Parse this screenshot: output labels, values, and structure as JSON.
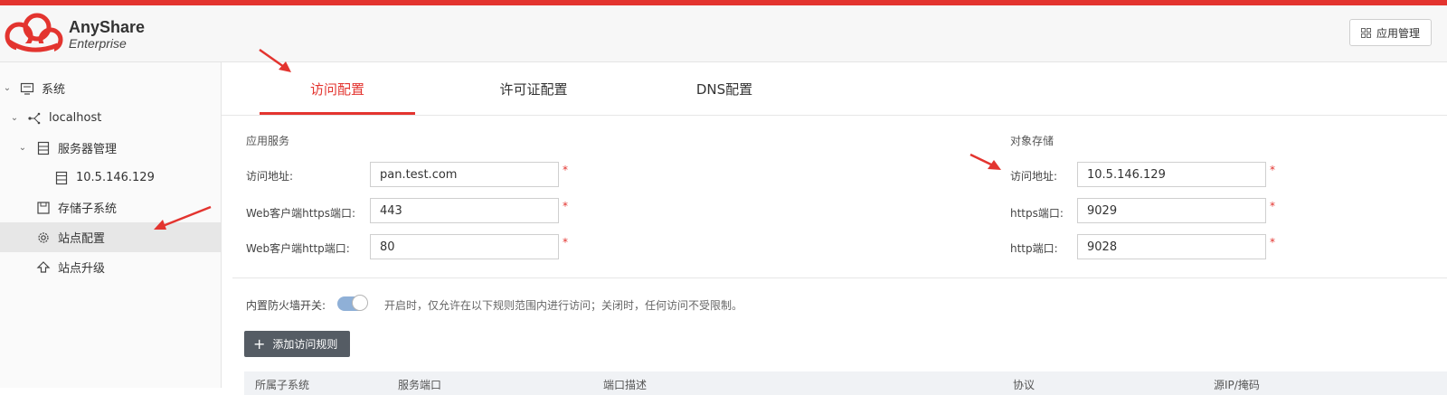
{
  "header": {
    "brand_name": "AnyShare",
    "brand_sub": "Enterprise",
    "app_management_label": "应用管理"
  },
  "sidebar": {
    "items": [
      {
        "label": "系统",
        "icon": "server-monitor-icon"
      },
      {
        "label": "localhost",
        "icon": "network-node-icon"
      },
      {
        "label": "服务器管理",
        "icon": "server-list-icon"
      },
      {
        "label": "10.5.146.129",
        "icon": "server-rack-icon"
      },
      {
        "label": "存储子系统",
        "icon": "storage-icon"
      },
      {
        "label": "站点配置",
        "icon": "gear-icon"
      },
      {
        "label": "站点升级",
        "icon": "upgrade-arrow-icon"
      }
    ]
  },
  "tabs": [
    {
      "label": "访问配置",
      "active": true
    },
    {
      "label": "许可证配置",
      "active": false
    },
    {
      "label": "DNS配置",
      "active": false
    }
  ],
  "app_service": {
    "title": "应用服务",
    "fields": [
      {
        "label": "访问地址:",
        "value": "pan.test.com"
      },
      {
        "label": "Web客户端https端口:",
        "value": "443"
      },
      {
        "label": "Web客户端http端口:",
        "value": "80"
      }
    ]
  },
  "object_storage": {
    "title": "对象存储",
    "fields": [
      {
        "label": "访问地址:",
        "value": "10.5.146.129"
      },
      {
        "label": "https端口:",
        "value": "9029"
      },
      {
        "label": "http端口:",
        "value": "9028"
      }
    ]
  },
  "required_mark": "*",
  "firewall": {
    "label": "内置防火墙开关:",
    "enabled": true,
    "hint": "开启时，仅允许在以下规则范围内进行访问；关闭时，任何访问不受限制。"
  },
  "add_rule_label": "添加访问规则",
  "table": {
    "headers": [
      "所属子系统",
      "服务端口",
      "端口描述",
      "协议",
      "源IP/掩码"
    ]
  },
  "colors": {
    "accent": "#e3342f",
    "toggle": "#8fb0d7",
    "button_dark": "#555c64"
  }
}
